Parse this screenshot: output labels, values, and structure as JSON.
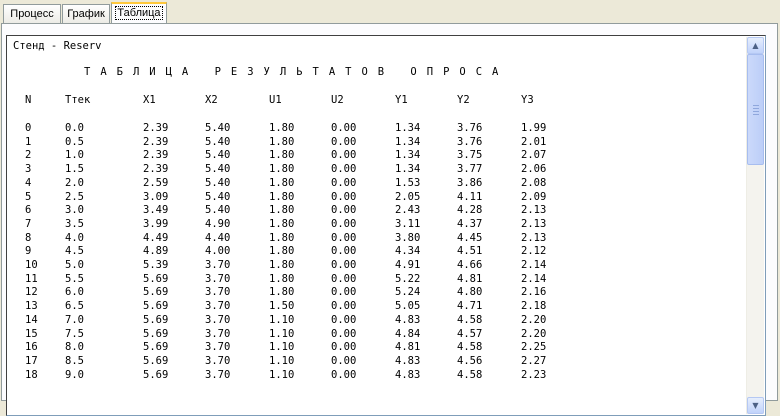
{
  "tabs": [
    {
      "label": "Процесс",
      "active": false
    },
    {
      "label": "График",
      "active": false
    },
    {
      "label": "Таблица",
      "active": true
    }
  ],
  "memo": {
    "header": "Стенд - Reserv",
    "caption": "ТАБЛИЦА РЕЗУЛЬТАТОВ ОПРОСА",
    "columns": [
      "N",
      "Tтек",
      "X1",
      "X2",
      "U1",
      "U2",
      "Y1",
      "Y2",
      "Y3"
    ],
    "rows": [
      [
        "0",
        "0.0",
        "2.39",
        "5.40",
        "1.80",
        "0.00",
        "1.34",
        "3.76",
        "1.99"
      ],
      [
        "1",
        "0.5",
        "2.39",
        "5.40",
        "1.80",
        "0.00",
        "1.34",
        "3.76",
        "2.01"
      ],
      [
        "2",
        "1.0",
        "2.39",
        "5.40",
        "1.80",
        "0.00",
        "1.34",
        "3.75",
        "2.07"
      ],
      [
        "3",
        "1.5",
        "2.39",
        "5.40",
        "1.80",
        "0.00",
        "1.34",
        "3.77",
        "2.06"
      ],
      [
        "4",
        "2.0",
        "2.59",
        "5.40",
        "1.80",
        "0.00",
        "1.53",
        "3.86",
        "2.08"
      ],
      [
        "5",
        "2.5",
        "3.09",
        "5.40",
        "1.80",
        "0.00",
        "2.05",
        "4.11",
        "2.09"
      ],
      [
        "6",
        "3.0",
        "3.49",
        "5.40",
        "1.80",
        "0.00",
        "2.43",
        "4.28",
        "2.13"
      ],
      [
        "7",
        "3.5",
        "3.99",
        "4.90",
        "1.80",
        "0.00",
        "3.11",
        "4.37",
        "2.13"
      ],
      [
        "8",
        "4.0",
        "4.49",
        "4.40",
        "1.80",
        "0.00",
        "3.80",
        "4.45",
        "2.13"
      ],
      [
        "9",
        "4.5",
        "4.89",
        "4.00",
        "1.80",
        "0.00",
        "4.34",
        "4.51",
        "2.12"
      ],
      [
        "10",
        "5.0",
        "5.39",
        "3.70",
        "1.80",
        "0.00",
        "4.91",
        "4.66",
        "2.14"
      ],
      [
        "11",
        "5.5",
        "5.69",
        "3.70",
        "1.80",
        "0.00",
        "5.22",
        "4.81",
        "2.14"
      ],
      [
        "12",
        "6.0",
        "5.69",
        "3.70",
        "1.80",
        "0.00",
        "5.24",
        "4.80",
        "2.16"
      ],
      [
        "13",
        "6.5",
        "5.69",
        "3.70",
        "1.50",
        "0.00",
        "5.05",
        "4.71",
        "2.18"
      ],
      [
        "14",
        "7.0",
        "5.69",
        "3.70",
        "1.10",
        "0.00",
        "4.83",
        "4.58",
        "2.20"
      ],
      [
        "15",
        "7.5",
        "5.69",
        "3.70",
        "1.10",
        "0.00",
        "4.84",
        "4.57",
        "2.20"
      ],
      [
        "16",
        "8.0",
        "5.69",
        "3.70",
        "1.10",
        "0.00",
        "4.81",
        "4.58",
        "2.25"
      ],
      [
        "17",
        "8.5",
        "5.69",
        "3.70",
        "1.10",
        "0.00",
        "4.83",
        "4.56",
        "2.27"
      ],
      [
        "18",
        "9.0",
        "5.69",
        "3.70",
        "1.10",
        "0.00",
        "4.83",
        "4.58",
        "2.23"
      ]
    ]
  },
  "scrollbar": {
    "up_icon": "chevron-up-icon",
    "down_icon": "chevron-down-icon"
  }
}
